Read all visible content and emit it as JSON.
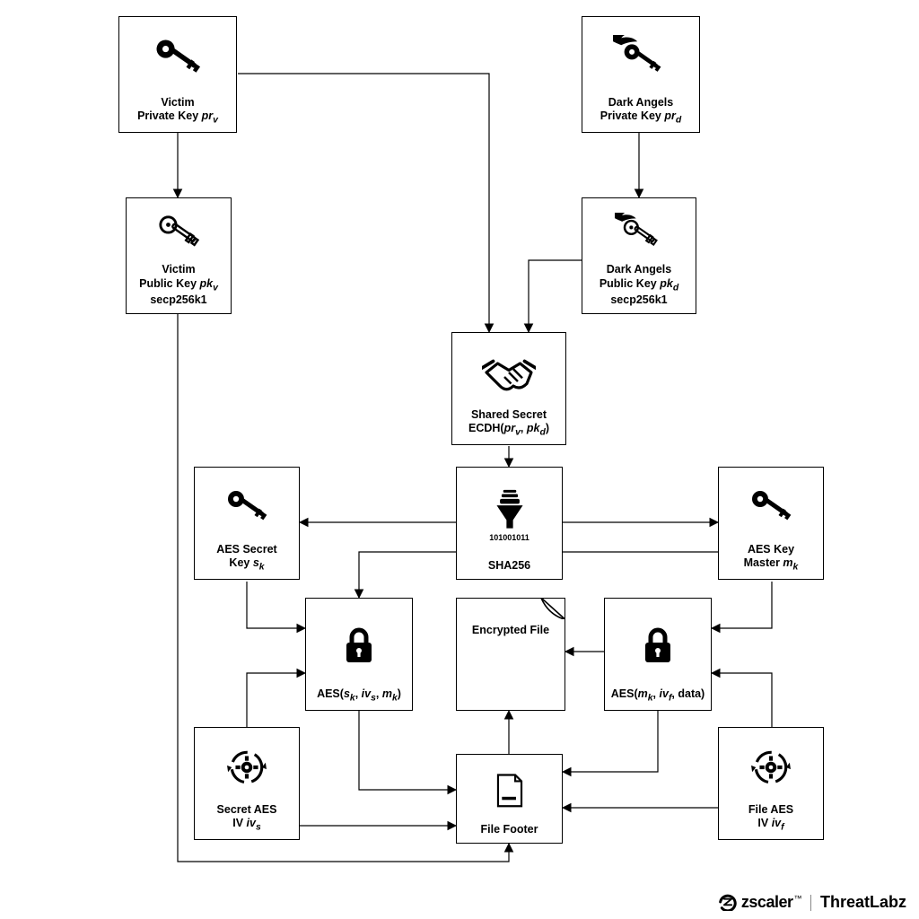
{
  "nodes": {
    "victim_priv": {
      "l1": "Victim",
      "l2": "Private Key ",
      "sym": "pr",
      "sub": "v"
    },
    "da_priv": {
      "l1": "Dark Angels",
      "l2": "Private Key ",
      "sym": "pr",
      "sub": "d"
    },
    "victim_pub": {
      "l1": "Victim",
      "l2": "Public Key ",
      "sym": "pk",
      "sub": "v",
      "l3": "secp256k1"
    },
    "da_pub": {
      "l1": "Dark Angels",
      "l2": "Public Key ",
      "sym": "pk",
      "sub": "d",
      "l3": "secp256k1"
    },
    "shared": {
      "l1": "Shared Secret",
      "l2": "ECDH(",
      "pA": "pr",
      "pAs": "v",
      "mid": ", ",
      "pB": "pk",
      "pBs": "d",
      "end": ")"
    },
    "sha256": {
      "l1": "SHA256",
      "bits": "101001011"
    },
    "aes_secret": {
      "l1": "AES Secret",
      "l2": "Key ",
      "sym": "s",
      "sub": "k"
    },
    "aes_master": {
      "l1": "AES Key",
      "l2": "Master ",
      "sym": "m",
      "sub": "k"
    },
    "aes_skmk": {
      "pre": "AES(",
      "a": "s",
      "as": "k",
      "c1": ", ",
      "b": "iv",
      "bs": "s",
      "c2": ", ",
      "c": "m",
      "cs": "k",
      "post": ")"
    },
    "aes_data": {
      "pre": "AES(",
      "a": "m",
      "as": "k",
      "c1": ", ",
      "b": "iv",
      "bs": "f",
      "c2": ", ",
      "post": "data)"
    },
    "encfile": {
      "l1": "Encrypted File"
    },
    "iv_s": {
      "l1": "Secret AES",
      "l2": "IV ",
      "sym": "iv",
      "sub": "s"
    },
    "iv_f": {
      "l1": "File AES",
      "l2": "IV ",
      "sym": "iv",
      "sub": "f"
    },
    "footer": {
      "l1": "File Footer"
    }
  },
  "logo": {
    "brand": "zscaler",
    "tm": "™",
    "lab": "ThreatLab",
    "z": "z"
  }
}
